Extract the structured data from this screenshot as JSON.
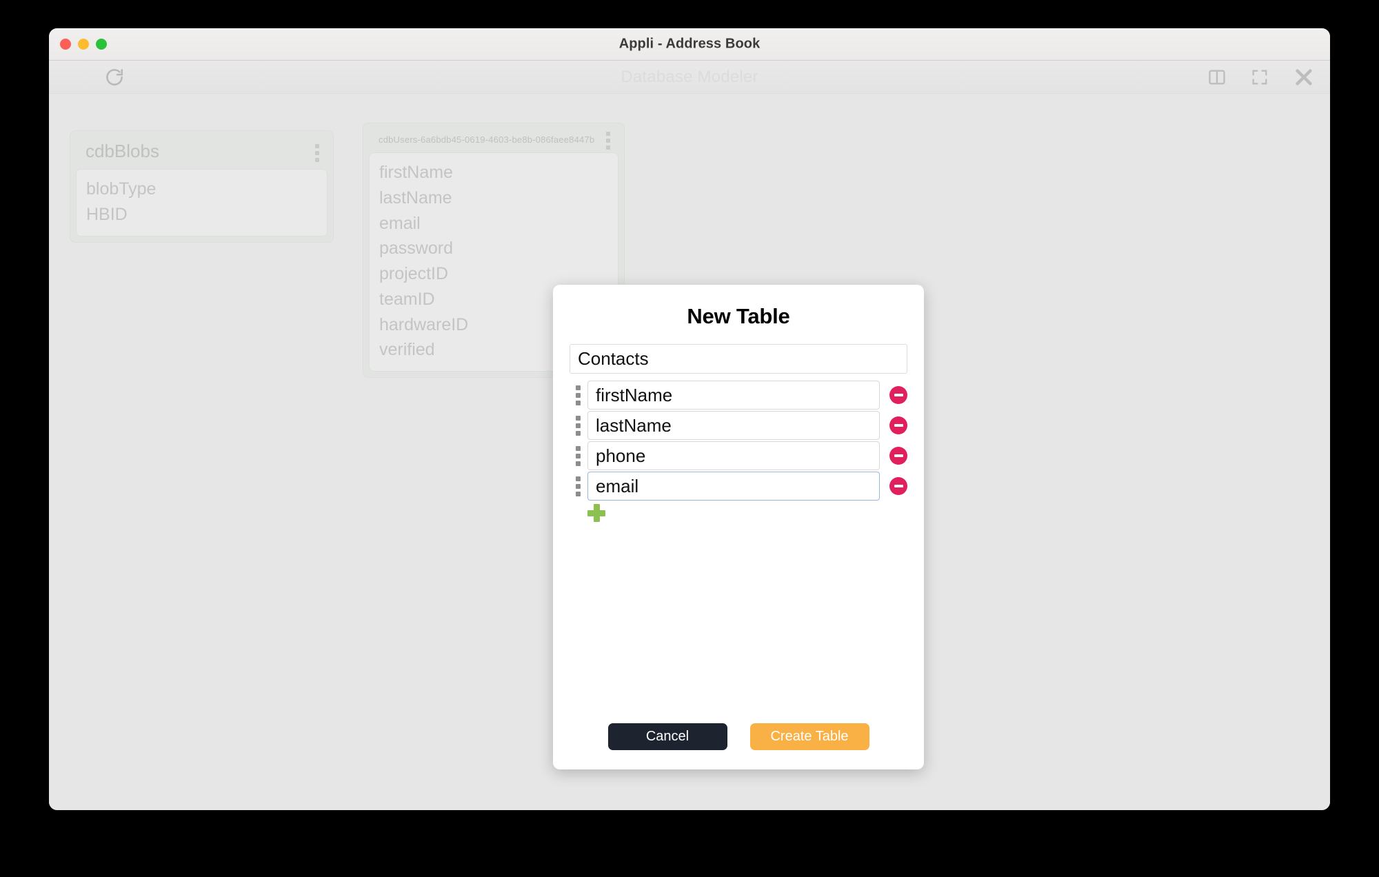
{
  "window": {
    "title": "Appli - Address Book",
    "traffic_lights": [
      "close",
      "minimize",
      "maximize"
    ]
  },
  "toolbar": {
    "refresh_icon": "refresh-icon",
    "modeler_title": "Database Modeler",
    "right_icons": [
      {
        "name": "split-view-icon"
      },
      {
        "name": "fullscreen-icon"
      },
      {
        "name": "close-icon"
      }
    ]
  },
  "canvas": {
    "tables": [
      {
        "name": "cdbBlobs",
        "menu_icon": "kebab-menu-icon",
        "fields": [
          "blobType",
          "HBID"
        ]
      },
      {
        "name": "cdbUsers-6a6bdb45-0619-4603-be8b-086faee8447b",
        "menu_icon": "kebab-menu-icon",
        "fields": [
          "firstName",
          "lastName",
          "email",
          "password",
          "projectID",
          "teamID",
          "hardwareID",
          "verified"
        ]
      }
    ]
  },
  "modal": {
    "title": "New Table",
    "table_name": {
      "value": "Contacts",
      "placeholder": "Table name"
    },
    "fields": [
      {
        "value": "firstName",
        "placeholder": "Field name",
        "focused": false
      },
      {
        "value": "lastName",
        "placeholder": "Field name",
        "focused": false
      },
      {
        "value": "phone",
        "placeholder": "Field name",
        "focused": false
      },
      {
        "value": "email",
        "placeholder": "Field name",
        "focused": true
      }
    ],
    "add_field_icon": "plus-icon",
    "remove_field_icon": "minus-circle-icon",
    "drag_handle_icon": "drag-handle-icon",
    "cancel_label": "Cancel",
    "create_label": "Create Table"
  },
  "colors": {
    "accent_orange": "#f9b044",
    "dark_button": "#1e2330",
    "remove_red": "#e01f5c",
    "add_green": "#8cc152",
    "focus_blue": "#93b7e0"
  }
}
